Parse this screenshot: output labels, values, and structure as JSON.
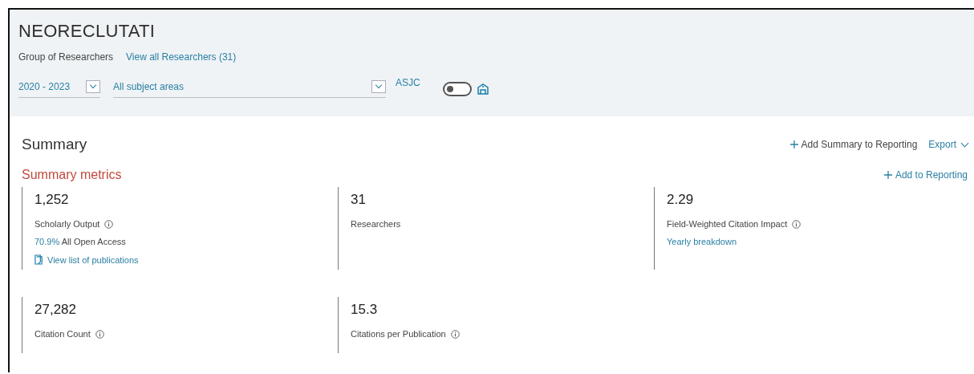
{
  "header": {
    "title": "NEORECLUTATI",
    "subtitle": "Group of Researchers",
    "researchers_link": "View all Researchers (31)",
    "year_range": {
      "value": "2020 - 2023"
    },
    "subject_areas": {
      "value": "All subject areas"
    },
    "asjc_label": "ASJC",
    "asjc_toggle": {
      "on": false
    }
  },
  "summary": {
    "title": "Summary",
    "add_summary": "Add Summary to Reporting",
    "export": "Export",
    "metrics_title": "Summary metrics",
    "add_to_reporting": "Add to Reporting",
    "metrics": [
      {
        "value": "1,252",
        "label": "Scholarly Output",
        "info": true,
        "lines": [
          {
            "kind": "percent",
            "highlight": "70.9%",
            "text": "All Open Access"
          },
          {
            "kind": "doc_link",
            "text": "View list of publications"
          }
        ]
      },
      {
        "value": "31",
        "label": "Researchers",
        "info": false
      },
      {
        "value": "2.29",
        "label": "Field-Weighted Citation Impact",
        "info": true,
        "lines": [
          {
            "kind": "link",
            "text": "Yearly breakdown"
          }
        ]
      },
      {
        "value": "27,282",
        "label": "Citation Count",
        "info": true
      },
      {
        "value": "15.3",
        "label": "Citations per Publication",
        "info": true
      }
    ]
  }
}
